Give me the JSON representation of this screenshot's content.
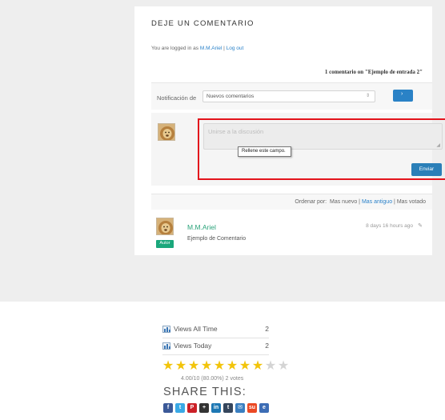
{
  "comments": {
    "heading": "DEJE UN COMENTARIO",
    "logged_in_prefix": "You are logged in as ",
    "logged_in_user": "M.M.Ariel",
    "logged_in_sep": " | ",
    "logout_label": "Log out",
    "count_text": "1 comentario on \"Ejemplo de entrada 2\"",
    "notification": {
      "label": "Notificación de",
      "selected": "Nuevos comentarios",
      "arrows": "⇕",
      "go_icon": "›"
    },
    "form": {
      "placeholder": "Unirse a la discusión",
      "tooltip": "Rellene este campo.",
      "submit_label": "Enviar",
      "resize_grip": "◢"
    },
    "sort": {
      "label": "Ordenar por:",
      "options": [
        "Mas nuevo",
        "Mas antiguo",
        "Mas votado"
      ],
      "separator": " | "
    },
    "comment": {
      "author": "M.M.Ariel",
      "badge": "Autor",
      "time": "8 days 16 hours ago",
      "edit_icon": "✎",
      "text": "Ejemplo de Comentario"
    }
  },
  "stats": {
    "views_all_time_label": "Views All Time",
    "views_all_time_value": "2",
    "views_today_label": "Views Today",
    "views_today_value": "2"
  },
  "rating": {
    "stars_filled": 8,
    "stars_total": 10,
    "star_glyph": "★",
    "text": "4.00/10 (80.00%) 2 votes"
  },
  "share": {
    "title": "SHARE THIS:",
    "icons": [
      {
        "name": "facebook-icon",
        "glyph": "f",
        "color": "#3b5998"
      },
      {
        "name": "twitter-icon",
        "glyph": "t",
        "color": "#3aa9e6"
      },
      {
        "name": "pinterest-icon",
        "glyph": "P",
        "color": "#cb2027"
      },
      {
        "name": "add-more-icon",
        "glyph": "+",
        "color": "#333333"
      },
      {
        "name": "linkedin-icon",
        "glyph": "in",
        "color": "#1e78b4"
      },
      {
        "name": "tumblr-icon",
        "glyph": "t",
        "color": "#35465c"
      },
      {
        "name": "email-icon",
        "glyph": "✉",
        "color": "#3a7fc1"
      },
      {
        "name": "stumbleupon-icon",
        "glyph": "su",
        "color": "#eb4924"
      },
      {
        "name": "evernote-icon",
        "glyph": "e",
        "color": "#3d6db5"
      }
    ]
  }
}
